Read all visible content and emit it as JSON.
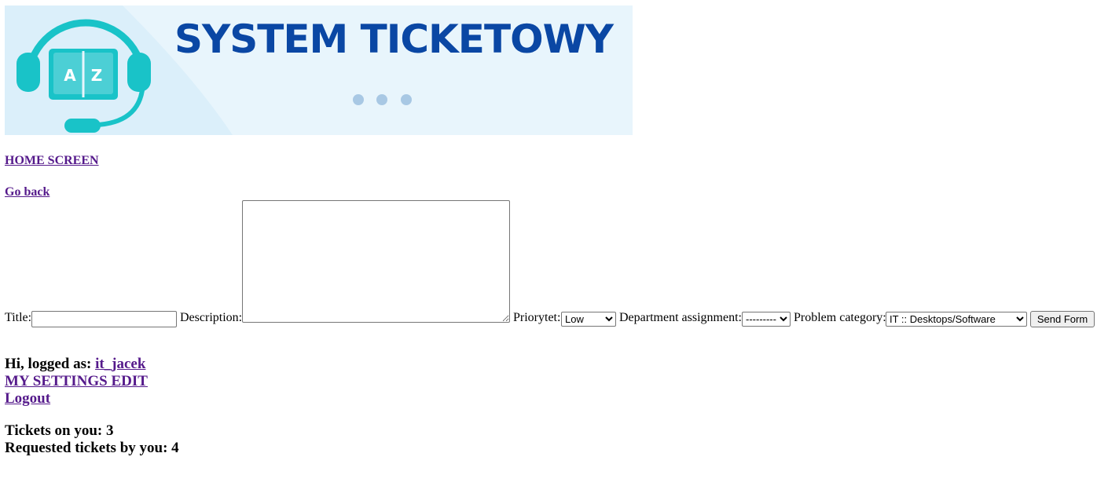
{
  "banner": {
    "title": "SYSTEM TICKETOWY",
    "book_letter_left": "A",
    "book_letter_right": "Z",
    "colors": {
      "title": "#0a47a4",
      "icon": "#19c3c8",
      "background": "#e8f5fc",
      "dots": "#a8c8e4"
    }
  },
  "nav": {
    "home_label": "HOME SCREEN",
    "back_label": "Go back"
  },
  "form": {
    "title_label": "Title:",
    "title_value": "",
    "description_label": "Description:",
    "description_value": "",
    "priority_label": "Priorytet:",
    "priority_selected": "Low",
    "department_label": "Department assignment:",
    "department_selected": "---------",
    "category_label": "Problem category:",
    "category_selected": "IT :: Desktops/Software",
    "submit_label": "Send Form"
  },
  "user": {
    "greeting": "Hi, logged as:",
    "username": "it_jacek",
    "settings_label": "MY SETTINGS EDIT",
    "logout_label": "Logout"
  },
  "stats": {
    "tickets_on_you_label": "Tickets on you:",
    "tickets_on_you": "3",
    "requested_label": "Requested tickets by you:",
    "requested": "4"
  },
  "link_color": "#551a8b"
}
